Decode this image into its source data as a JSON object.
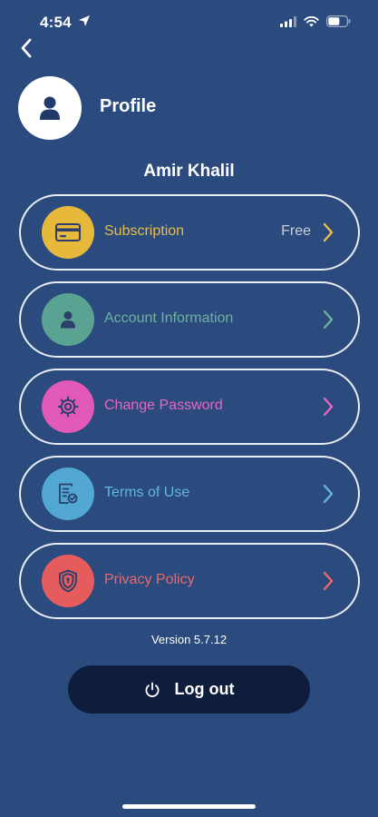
{
  "status_bar": {
    "time": "4:54",
    "icons": [
      "location-arrow-icon",
      "signal-icon",
      "wifi-icon",
      "battery-icon"
    ]
  },
  "header": {
    "title": "Profile",
    "back_icon": "chevron-left-icon",
    "avatar_icon": "user-icon"
  },
  "user": {
    "name": "Amir Khalil"
  },
  "menu": {
    "items": [
      {
        "label": "Subscription",
        "value": "Free",
        "icon": "credit-card-icon",
        "color": "#e6b93a",
        "text_color": "#e7be48"
      },
      {
        "label": "Account Information",
        "value": "",
        "icon": "user-icon",
        "color": "#5aa291",
        "text_color": "#6db2a0"
      },
      {
        "label": "Change Password",
        "value": "",
        "icon": "gear-icon",
        "color": "#e159b9",
        "text_color": "#e866c2"
      },
      {
        "label": "Terms of Use",
        "value": "",
        "icon": "document-icon",
        "color": "#52a7d3",
        "text_color": "#63b6dc"
      },
      {
        "label": "Privacy Policy",
        "value": "",
        "icon": "shield-icon",
        "color": "#e45c5c",
        "text_color": "#ea6a6a"
      }
    ]
  },
  "footer": {
    "version": "Version 5.7.12",
    "logout_label": "Log out",
    "logout_icon": "power-icon"
  },
  "colors": {
    "background": "#2b4a7e",
    "logout_button": "#0f1d3d",
    "pill_border": "#e8edf5"
  }
}
